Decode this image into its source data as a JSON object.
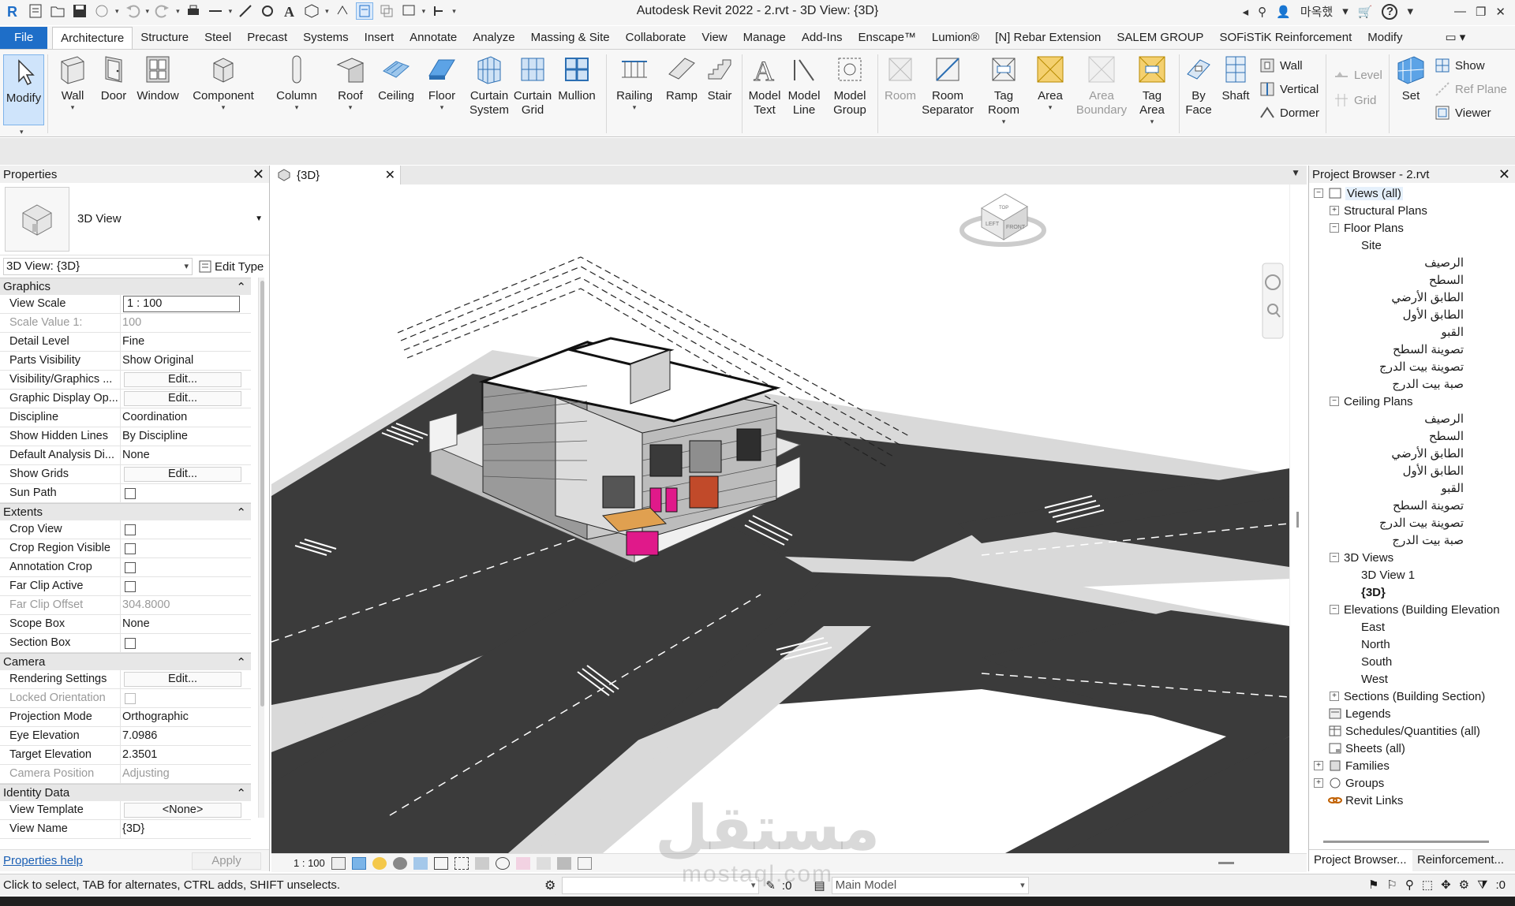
{
  "window": {
    "title": "Autodesk Revit 2022 - 2.rvt - 3D View: {3D}",
    "user_name": "마옥했",
    "help_label": "?"
  },
  "ribbon_tabs": [
    "File",
    "Architecture",
    "Structure",
    "Steel",
    "Precast",
    "Systems",
    "Insert",
    "Annotate",
    "Analyze",
    "Massing & Site",
    "Collaborate",
    "View",
    "Manage",
    "Add-Ins",
    "Enscape™",
    "Lumion®",
    "[N] Rebar Extension",
    "SALEM GROUP",
    "SOFiSTiK Reinforcement",
    "Modify"
  ],
  "active_tab": "Architecture",
  "ribbon": {
    "modify": "Modify",
    "wall": "Wall",
    "door": "Door",
    "window": "Window",
    "component": "Component",
    "column": "Column",
    "roof": "Roof",
    "ceiling": "Ceiling",
    "floor": "Floor",
    "curtain_system_1": "Curtain",
    "curtain_system_2": "System",
    "curtain_grid_1": "Curtain",
    "curtain_grid_2": "Grid",
    "mullion": "Mullion",
    "railing": "Railing",
    "ramp": "Ramp",
    "stair": "Stair",
    "model_text_1": "Model",
    "model_text_2": "Text",
    "model_line_1": "Model",
    "model_line_2": "Line",
    "model_group_1": "Model",
    "model_group_2": "Group",
    "room": "Room",
    "room_sep_1": "Room",
    "room_sep_2": "Separator",
    "tag_room_1": "Tag",
    "tag_room_2": "Room",
    "area": "Area",
    "area_boundary_1": "Area",
    "area_boundary_2": "Boundary",
    "tag_area_1": "Tag",
    "tag_area_2": "Area",
    "by_face_1": "By",
    "by_face_2": "Face",
    "shaft": "Shaft",
    "wall_small": "Wall",
    "vertical": "Vertical",
    "dormer": "Dormer",
    "level": "Level",
    "grid": "Grid",
    "set": "Set",
    "show": "Show",
    "ref_plane": "Ref  Plane",
    "viewer": "Viewer"
  },
  "properties": {
    "title": "Properties",
    "type_name": "3D View",
    "selector": "3D View: {3D}",
    "edit_type": "Edit Type",
    "groups": [
      {
        "name": "Graphics",
        "rows": [
          {
            "k": "View Scale",
            "v": "1 : 100",
            "kind": "input"
          },
          {
            "k": "Scale Value    1:",
            "v": "100",
            "kind": "dim"
          },
          {
            "k": "Detail Level",
            "v": "Fine",
            "kind": "text"
          },
          {
            "k": "Parts Visibility",
            "v": "Show Original",
            "kind": "text"
          },
          {
            "k": "Visibility/Graphics ...",
            "v": "Edit...",
            "kind": "edit"
          },
          {
            "k": "Graphic Display Op...",
            "v": "Edit...",
            "kind": "edit"
          },
          {
            "k": "Discipline",
            "v": "Coordination",
            "kind": "text"
          },
          {
            "k": "Show Hidden Lines",
            "v": "By Discipline",
            "kind": "text"
          },
          {
            "k": "Default Analysis Di...",
            "v": "None",
            "kind": "text"
          },
          {
            "k": "Show Grids",
            "v": "Edit...",
            "kind": "edit"
          },
          {
            "k": "Sun Path",
            "v": "",
            "kind": "check"
          }
        ]
      },
      {
        "name": "Extents",
        "rows": [
          {
            "k": "Crop View",
            "v": "",
            "kind": "check"
          },
          {
            "k": "Crop Region Visible",
            "v": "",
            "kind": "check"
          },
          {
            "k": "Annotation Crop",
            "v": "",
            "kind": "check"
          },
          {
            "k": "Far Clip Active",
            "v": "",
            "kind": "check"
          },
          {
            "k": "Far Clip Offset",
            "v": "304.8000",
            "kind": "dim"
          },
          {
            "k": "Scope Box",
            "v": "None",
            "kind": "text"
          },
          {
            "k": "Section Box",
            "v": "",
            "kind": "check"
          }
        ]
      },
      {
        "name": "Camera",
        "rows": [
          {
            "k": "Rendering Settings",
            "v": "Edit...",
            "kind": "edit"
          },
          {
            "k": "Locked Orientation",
            "v": "",
            "kind": "dimcheck"
          },
          {
            "k": "Projection Mode",
            "v": "Orthographic",
            "kind": "text"
          },
          {
            "k": "Eye Elevation",
            "v": "7.0986",
            "kind": "text"
          },
          {
            "k": "Target Elevation",
            "v": "2.3501",
            "kind": "text"
          },
          {
            "k": "Camera Position",
            "v": "Adjusting",
            "kind": "dim"
          }
        ]
      },
      {
        "name": "Identity Data",
        "rows": [
          {
            "k": "View Template",
            "v": "<None>",
            "kind": "edit"
          },
          {
            "k": "View Name",
            "v": "{3D}",
            "kind": "text"
          }
        ]
      }
    ],
    "help_link": "Properties help",
    "apply": "Apply"
  },
  "view": {
    "tab_label": "{3D}",
    "scale": "1 : 100",
    "cube_top": "TOP",
    "cube_left": "LEFT",
    "cube_front": "FRONT"
  },
  "project_browser": {
    "title": "Project Browser - 2.rvt",
    "nodes": [
      {
        "label": "Views (all)",
        "level": 0,
        "exp": "-",
        "icon": "views-icon",
        "hl": true
      },
      {
        "label": "Structural Plans",
        "level": 1,
        "exp": "+"
      },
      {
        "label": "Floor Plans",
        "level": 1,
        "exp": "-"
      },
      {
        "label": "Site",
        "level": 2
      },
      {
        "label": "الرصيف",
        "level": 2,
        "rtl": true
      },
      {
        "label": "السطح",
        "level": 2,
        "rtl": true
      },
      {
        "label": "الطابق الأرضي",
        "level": 2,
        "rtl": true
      },
      {
        "label": "الطابق الأول",
        "level": 2,
        "rtl": true
      },
      {
        "label": "القبو",
        "level": 2,
        "rtl": true
      },
      {
        "label": "تصوينة السطح",
        "level": 2,
        "rtl": true
      },
      {
        "label": "تصوينة بيت الدرج",
        "level": 2,
        "rtl": true
      },
      {
        "label": "صبة بيت الدرج",
        "level": 2,
        "rtl": true
      },
      {
        "label": "Ceiling Plans",
        "level": 1,
        "exp": "-"
      },
      {
        "label": "الرصيف",
        "level": 2,
        "rtl": true
      },
      {
        "label": "السطح",
        "level": 2,
        "rtl": true
      },
      {
        "label": "الطابق الأرضي",
        "level": 2,
        "rtl": true
      },
      {
        "label": "الطابق الأول",
        "level": 2,
        "rtl": true
      },
      {
        "label": "القبو",
        "level": 2,
        "rtl": true
      },
      {
        "label": "تصوينة السطح",
        "level": 2,
        "rtl": true
      },
      {
        "label": "تصوينة بيت الدرج",
        "level": 2,
        "rtl": true
      },
      {
        "label": "صبة بيت الدرج",
        "level": 2,
        "rtl": true
      },
      {
        "label": "3D Views",
        "level": 1,
        "exp": "-"
      },
      {
        "label": "3D View 1",
        "level": 2
      },
      {
        "label": "{3D}",
        "level": 2,
        "bold": true
      },
      {
        "label": "Elevations (Building Elevation",
        "level": 1,
        "exp": "-"
      },
      {
        "label": "East",
        "level": 2
      },
      {
        "label": "North",
        "level": 2
      },
      {
        "label": "South",
        "level": 2
      },
      {
        "label": "West",
        "level": 2
      },
      {
        "label": "Sections (Building Section)",
        "level": 1,
        "exp": "+"
      },
      {
        "label": "Legends",
        "level": 0,
        "icon": "legends-icon"
      },
      {
        "label": "Schedules/Quantities (all)",
        "level": 0,
        "icon": "schedules-icon"
      },
      {
        "label": "Sheets (all)",
        "level": 0,
        "icon": "sheets-icon"
      },
      {
        "label": "Families",
        "level": 0,
        "exp": "+",
        "icon": "families-icon"
      },
      {
        "label": "Groups",
        "level": 0,
        "exp": "+",
        "icon": "groups-icon"
      },
      {
        "label": "Revit Links",
        "level": 0,
        "icon": "links-icon"
      }
    ],
    "tab_browser": "Project Browser...",
    "tab_reinforcement": "Reinforcement..."
  },
  "status": {
    "text": "Click to select, TAB for alternates, CTRL adds, SHIFT unselects.",
    "count_left": ":0",
    "model": "Main Model",
    "filter_count": ":0"
  },
  "watermark": {
    "arabic": "مستقل",
    "latin": "mostaql.com"
  },
  "colors": {
    "file_tab": "#1e6ec8",
    "road": "#3a3a3a",
    "sidewalk": "#d8d8d8",
    "accent_pink": "#e0198a"
  }
}
